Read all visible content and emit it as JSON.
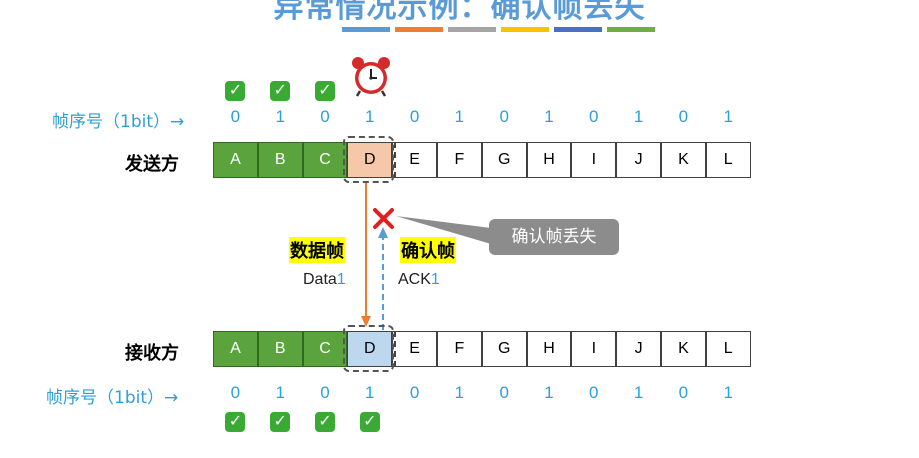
{
  "title": "异常情况示例：确认帧丢失",
  "stripe_colors": [
    "#5b9bd5",
    "#ed7d31",
    "#a5a5a5",
    "#ffc000",
    "#4472c4",
    "#70ad47"
  ],
  "sender": {
    "label": "发送方",
    "seq_label": "帧序号（1bit）→",
    "seq_numbers": [
      "0",
      "1",
      "0",
      "1",
      "0",
      "1",
      "0",
      "1",
      "0",
      "1",
      "0",
      "1"
    ],
    "frames": [
      "A",
      "B",
      "C",
      "D",
      "E",
      "F",
      "G",
      "H",
      "I",
      "J",
      "K",
      "L"
    ],
    "acked_count": 3,
    "timer_icon": "alarm-clock-icon"
  },
  "receiver": {
    "label": "接收方",
    "seq_label": "帧序号（1bit）→",
    "seq_numbers": [
      "0",
      "1",
      "0",
      "1",
      "0",
      "1",
      "0",
      "1",
      "0",
      "1",
      "0",
      "1"
    ],
    "frames": [
      "A",
      "B",
      "C",
      "D",
      "E",
      "F",
      "G",
      "H",
      "I",
      "J",
      "K",
      "L"
    ],
    "received_count": 4
  },
  "data_frame": {
    "label": "数据帧",
    "name": "Data",
    "num": "1"
  },
  "ack_frame": {
    "label": "确认帧",
    "name": "ACK",
    "num": "1"
  },
  "callout": "确认帧丢失",
  "check_icon": "✓",
  "colors": {
    "acked": "#5aa33d",
    "current_sender": "#f4c8a8",
    "current_receiver": "#bdd7ee",
    "lost_marker": "#e02020"
  }
}
